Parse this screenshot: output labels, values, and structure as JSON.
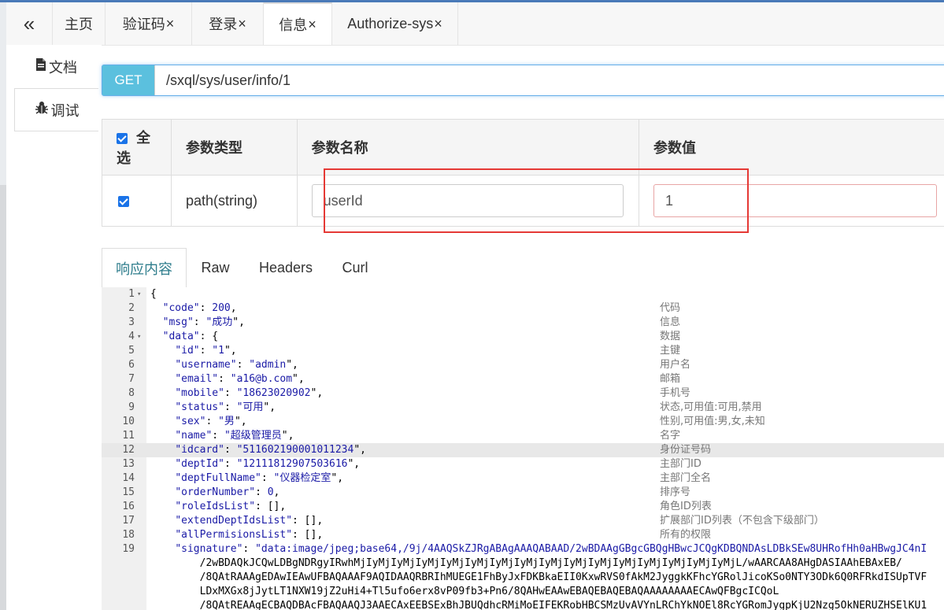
{
  "tabs": [
    {
      "label": "主页",
      "closable": false
    },
    {
      "label": "验证码",
      "closable": true
    },
    {
      "label": "登录",
      "closable": true
    },
    {
      "label": "信息",
      "closable": true,
      "active": true
    },
    {
      "label": "Authorize-sys",
      "closable": true
    }
  ],
  "tab_close_glyph": "×",
  "collapse_glyph": "«",
  "sidebar": {
    "items": [
      {
        "label": "文档",
        "icon": "document-icon"
      },
      {
        "label": "调试",
        "icon": "bug-icon",
        "active": true
      }
    ]
  },
  "request": {
    "method": "GET",
    "url": "/sxql/sys/user/info/1"
  },
  "params": {
    "select_all_label": "全选",
    "headers": [
      "参数类型",
      "参数名称",
      "参数值"
    ],
    "rows": [
      {
        "checked": true,
        "type": "path(string)",
        "name": "userId",
        "value": "1"
      }
    ]
  },
  "response_tabs": [
    "响应内容",
    "Raw",
    "Headers",
    "Curl"
  ],
  "response_lines": [
    {
      "no": "1",
      "fold": true,
      "code": "{",
      "comment": ""
    },
    {
      "no": "2",
      "code": "  \"code\": 200,",
      "comment": "代码"
    },
    {
      "no": "3",
      "code": "  \"msg\": \"成功\",",
      "comment": "信息"
    },
    {
      "no": "4",
      "fold": true,
      "code": "  \"data\": {",
      "comment": "数据"
    },
    {
      "no": "5",
      "code": "    \"id\": \"1\",",
      "comment": "主键"
    },
    {
      "no": "6",
      "code": "    \"username\": \"admin\",",
      "comment": "用户名"
    },
    {
      "no": "7",
      "code": "    \"email\": \"a16@b.com\",",
      "comment": "邮箱"
    },
    {
      "no": "8",
      "code": "    \"mobile\": \"18623020902\",",
      "comment": "手机号"
    },
    {
      "no": "9",
      "code": "    \"status\": \"可用\",",
      "comment": "状态,可用值:可用,禁用"
    },
    {
      "no": "10",
      "code": "    \"sex\": \"男\",",
      "comment": "性别,可用值:男,女,未知"
    },
    {
      "no": "11",
      "code": "    \"name\": \"超级管理员\",",
      "comment": "名字"
    },
    {
      "no": "12",
      "code": "    \"idcard\": \"511602190001011234\",",
      "comment": "身份证号码",
      "highlight": true
    },
    {
      "no": "13",
      "code": "    \"deptId\": \"1211181290750361­6\",",
      "comment": "主部门ID"
    },
    {
      "no": "14",
      "code": "    \"deptFullName\": \"仪器检定室\",",
      "comment": "主部门全名"
    },
    {
      "no": "15",
      "code": "    \"orderNumber\": 0,",
      "comment": "排序号"
    },
    {
      "no": "16",
      "code": "    \"roleIdsList\": [],",
      "comment": "角色ID列表"
    },
    {
      "no": "17",
      "code": "    \"extendDeptIdsList\": [],",
      "comment": "扩展部门ID列表（不包含下级部门）"
    },
    {
      "no": "18",
      "code": "    \"allPermisionsList\": [],",
      "comment": "所有的权限"
    },
    {
      "no": "19",
      "code": "    \"signature\": \"data:image/jpeg;base64,/9j/4AAQSkZJRgABAgAAAQABAAD/2wBDAAgGBgcGBQgHBwcJCQgKDBQNDAsLDBkSEw8UHRofHh0aHBwgJC4nI",
      "comment": ""
    },
    {
      "no": "",
      "code": "        /2wBDAQkJCQwLDBgNDRgyIRwhMjIyMjIyMjIyMjIyMjIyMjIyMjIyMjIyMjIyMjIyMjIyMjIyMjIyMjIyMjIyMjL/wAARCAA8AHgDASIAAhEBAxEB/",
      "comment": ""
    },
    {
      "no": "",
      "code": "        /8QAtRAAAgEDAwIEAwUFBAQAAAF9AQIDAAQRBRIhMUEGE1FhByJxFDKBkaEII0KxwRVS0fAkM2JyggkKFhcYGRolJicoKSo0NTY3ODk6Q0RFRkdISUpTVF",
      "comment": ""
    },
    {
      "no": "",
      "code": "        LDxMXGx8jJytLT1NXW19jZ2uHi4+Tl5ufo6erx8vP09fb3+Pn6/8QAHwEAAwEBAQEBAQEBAQAAAAAAAAECAwQFBgcICQoL",
      "comment": ""
    },
    {
      "no": "",
      "code": "        /8QAtREAAgECBAQDBAcFBAQAAQJ3AAECAxEEBSExBhJBUQdhcRMiMoEIFEKRobHBCSMzUvAVYnLRChYkNOEl8RcYGRomJygpKjU2Nzg5OkNERUZHSElKU1",
      "comment": ""
    }
  ]
}
